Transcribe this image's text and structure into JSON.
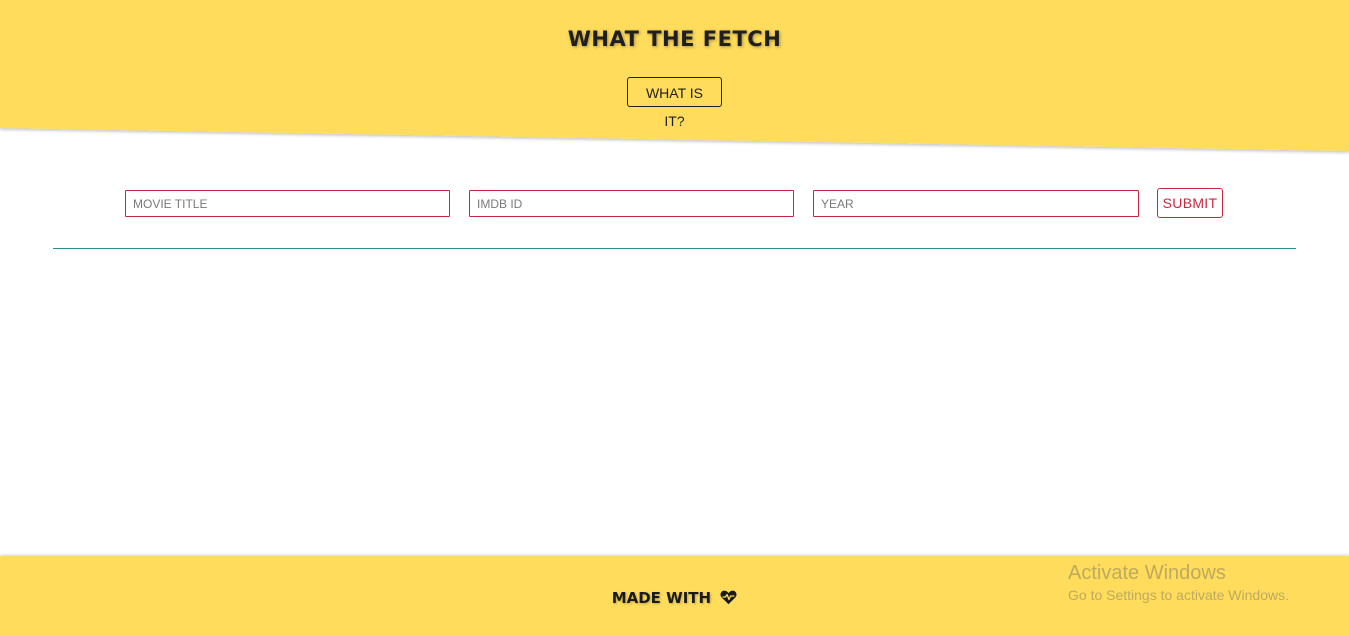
{
  "header": {
    "title": "WHAT THE FETCH",
    "info_button": "WHAT IS IT?",
    "background_color": "#ffdc5c"
  },
  "form": {
    "title_placeholder": "MOVIE TITLE",
    "imdb_placeholder": "IMDB ID",
    "year_placeholder": "YEAR",
    "submit_label": "SUBMIT",
    "accent_color": "#c8283f"
  },
  "footer": {
    "text": "MADE WITH",
    "icon": "heart-icon",
    "background_color": "#ffdc5c"
  },
  "watermark": {
    "line1": "Activate Windows",
    "line2": "Go to Settings to activate Windows."
  }
}
